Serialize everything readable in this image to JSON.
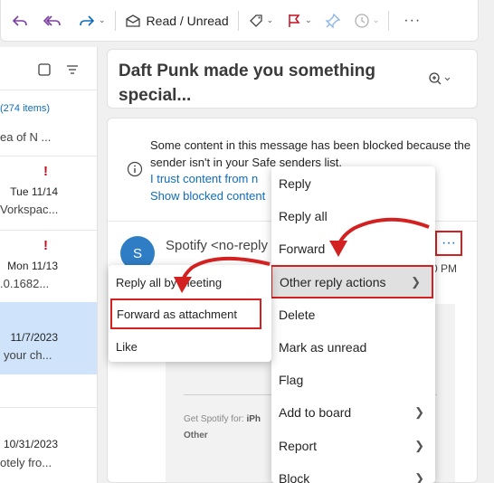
{
  "toolbar": {
    "read_unread_label": "Read / Unread",
    "icons": [
      "reply-icon",
      "reply-all-icon",
      "forward-icon",
      "envelope-icon",
      "tag-icon",
      "flag-icon",
      "pin-icon",
      "clock-icon",
      "more-icon"
    ]
  },
  "message_list": {
    "count_label": "(274 items)",
    "rows": [
      {
        "date": "",
        "snippet": "ea of N ..."
      },
      {
        "date": "Tue 11/14",
        "snippet": "Vorkspac...",
        "important": true
      },
      {
        "date": "Mon 11/13",
        "snippet": ".0.1682...",
        "important": true
      },
      {
        "date": "11/7/2023",
        "snippet": "your ch...",
        "selected": true
      },
      {
        "date": "10/31/2023",
        "snippet": "otely fro..."
      }
    ]
  },
  "reading_pane": {
    "subject": "Daft Punk made you something special...",
    "blocked_notice": "Some content in this message has been blocked because the sender isn't in your Safe senders list.",
    "trust_link": "I trust content from n",
    "show_blocked_link": "Show blocked content",
    "avatar_initial": "S",
    "sender": "Spotify <no-reply",
    "time_fragment": "0 PM",
    "more_label": "···",
    "get_spotify_label": "Get Spotify for:",
    "get_spotify_device": "iPh",
    "other_label": "Other"
  },
  "context_menu": {
    "items": [
      {
        "label": "Reply",
        "submenu": false
      },
      {
        "label": "Reply all",
        "submenu": false
      },
      {
        "label": "Forward",
        "submenu": false
      },
      {
        "label": "Other reply actions",
        "submenu": true,
        "highlighted": true
      },
      {
        "label": "Delete",
        "submenu": false
      },
      {
        "label": "Mark as unread",
        "submenu": false
      },
      {
        "label": "Flag",
        "submenu": false
      },
      {
        "label": "Add to board",
        "submenu": true
      },
      {
        "label": "Report",
        "submenu": true
      },
      {
        "label": "Block",
        "submenu": true
      }
    ]
  },
  "submenu": {
    "items": [
      {
        "label": "Reply all by meeting"
      },
      {
        "label": "Forward as attachment",
        "highlighted": true
      },
      {
        "label": "Like"
      }
    ]
  },
  "colors": {
    "accent": "#0f6cbd",
    "annotation_red": "#d32020",
    "importance_red": "#c50f1f",
    "selected_row": "#cfe4fa",
    "avatar": "#2f7dc4"
  }
}
